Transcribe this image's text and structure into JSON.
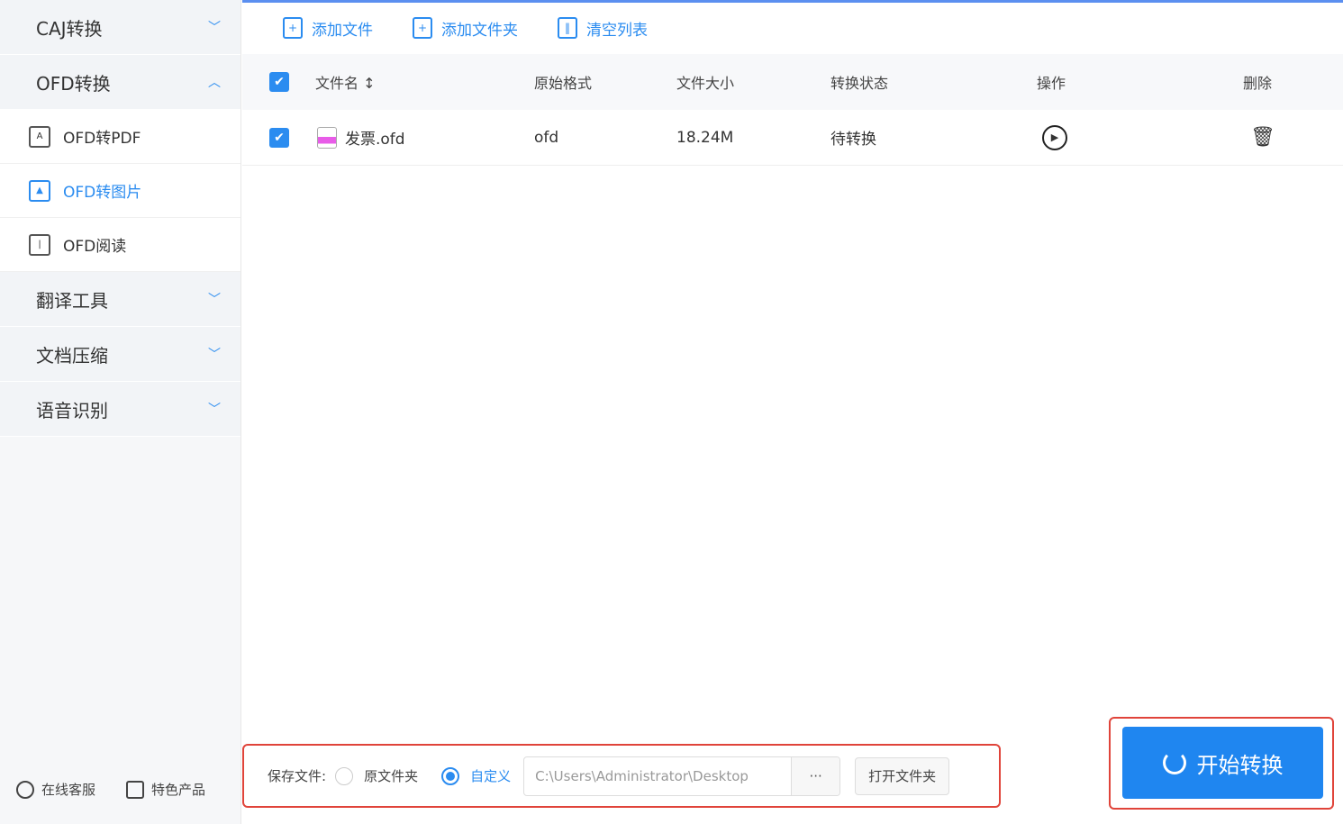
{
  "sidebar": {
    "groups": [
      {
        "label": "CAJ转换"
      },
      {
        "label": "OFD转换"
      },
      {
        "label": "翻译工具"
      },
      {
        "label": "文档压缩"
      },
      {
        "label": "语音识别"
      }
    ],
    "sub_items": [
      {
        "label": "OFD转PDF"
      },
      {
        "label": "OFD转图片"
      },
      {
        "label": "OFD阅读"
      }
    ],
    "footer": {
      "service": "在线客服",
      "products": "特色产品"
    }
  },
  "toolbar": {
    "add_file": "添加文件",
    "add_folder": "添加文件夹",
    "clear": "清空列表"
  },
  "table": {
    "headers": {
      "name": "文件名",
      "format": "原始格式",
      "size": "文件大小",
      "status": "转换状态",
      "action": "操作",
      "delete": "删除"
    },
    "rows": [
      {
        "name": "发票.ofd",
        "format": "ofd",
        "size": "18.24M",
        "status": "待转换"
      }
    ]
  },
  "save": {
    "label": "保存文件:",
    "option_original": "原文件夹",
    "option_custom": "自定义",
    "path": "C:\\Users\\Administrator\\Desktop",
    "browse": "···",
    "open_folder": "打开文件夹"
  },
  "start_button": "开始转换"
}
